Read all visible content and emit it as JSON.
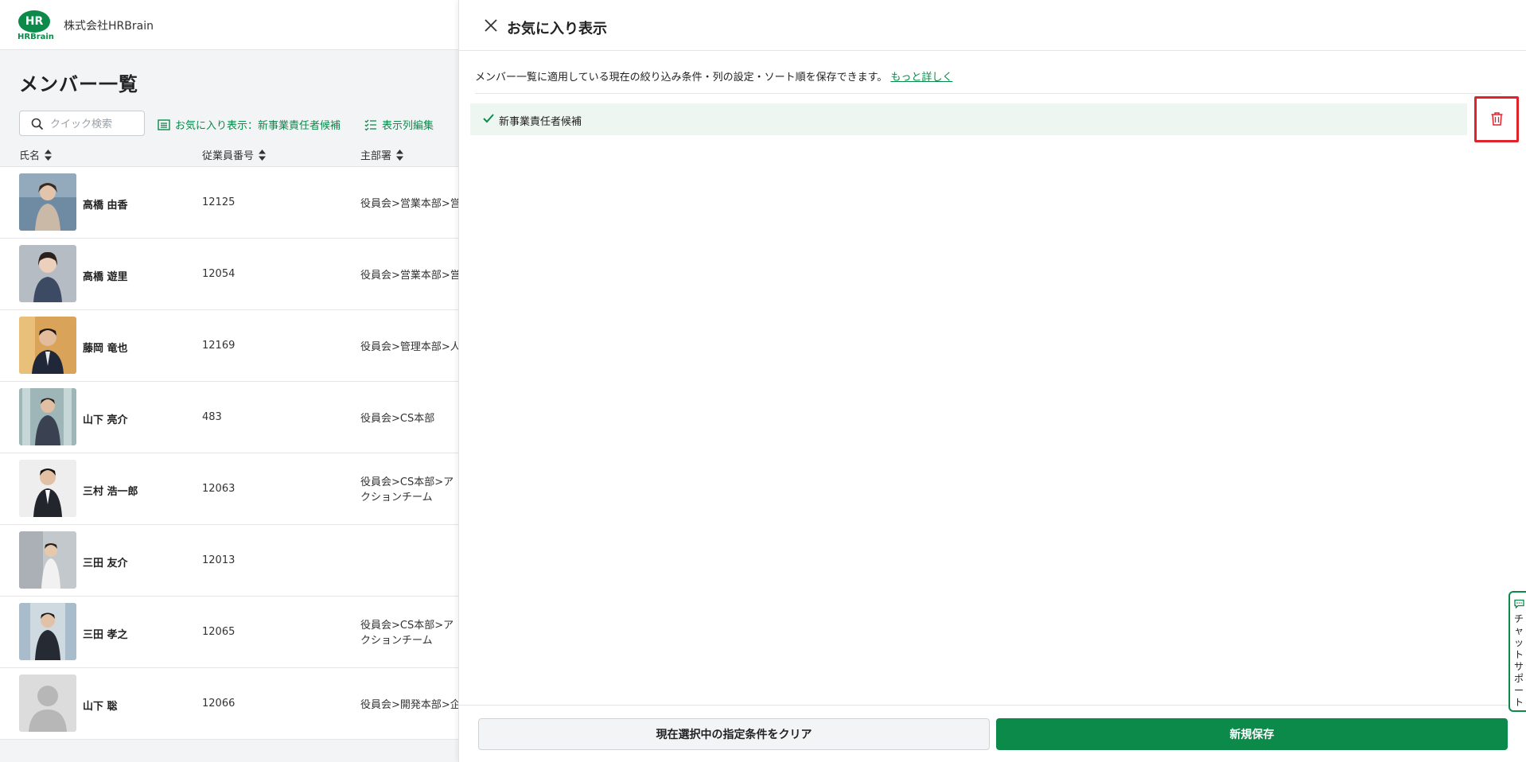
{
  "header": {
    "logo": {
      "mark": "HR",
      "word": "HRBrain"
    },
    "company": "株式会社HRBrain"
  },
  "page": {
    "title": "メンバー一覧"
  },
  "toolbar": {
    "search_placeholder": "クイック検索",
    "favorite_link": "お気に入り表示：新事業責任者候補",
    "columns_link": "表示列編集"
  },
  "table": {
    "columns": [
      "氏名",
      "従業員番号",
      "主部署"
    ],
    "rows": [
      {
        "name": "高橋 由香",
        "employee_no": "12125",
        "dept": "役員会>営業本部>営"
      },
      {
        "name": "高橋 遊里",
        "employee_no": "12054",
        "dept": "役員会>営業本部>営"
      },
      {
        "name": "藤岡 竜也",
        "employee_no": "12169",
        "dept": "役員会>管理本部>人"
      },
      {
        "name": "山下 亮介",
        "employee_no": "483",
        "dept": "役員会>CS本部"
      },
      {
        "name": "三村 浩一郎",
        "employee_no": "12063",
        "dept": "役員会>CS本部>アクションチーム"
      },
      {
        "name": "三田 友介",
        "employee_no": "12013",
        "dept": ""
      },
      {
        "name": "三田 孝之",
        "employee_no": "12065",
        "dept": "役員会>CS本部>アクションチーム"
      },
      {
        "name": "山下 聡",
        "employee_no": "12066",
        "dept": "役員会>開発本部>企"
      }
    ]
  },
  "panel": {
    "title": "お気に入り表示",
    "description": "メンバー一覧に適用している現在の絞り込み条件・列の設定・ソート順を保存できます。",
    "more_link": "もっと詳しく",
    "favorites": [
      {
        "label": "新事業責任者候補",
        "selected": true
      }
    ],
    "clear_button": "現在選択中の指定条件をクリア",
    "save_button": "新規保存"
  },
  "chat": {
    "label": "チャットサポート"
  },
  "colors": {
    "brand": "#0b8a4a",
    "danger": "#e0232b",
    "selected_bg": "#eef6f1"
  },
  "icons": [
    "close-icon",
    "search-icon",
    "list-icon",
    "checklist-icon",
    "sort-icon",
    "check-icon",
    "trash-icon",
    "chat-bubble-icon"
  ]
}
